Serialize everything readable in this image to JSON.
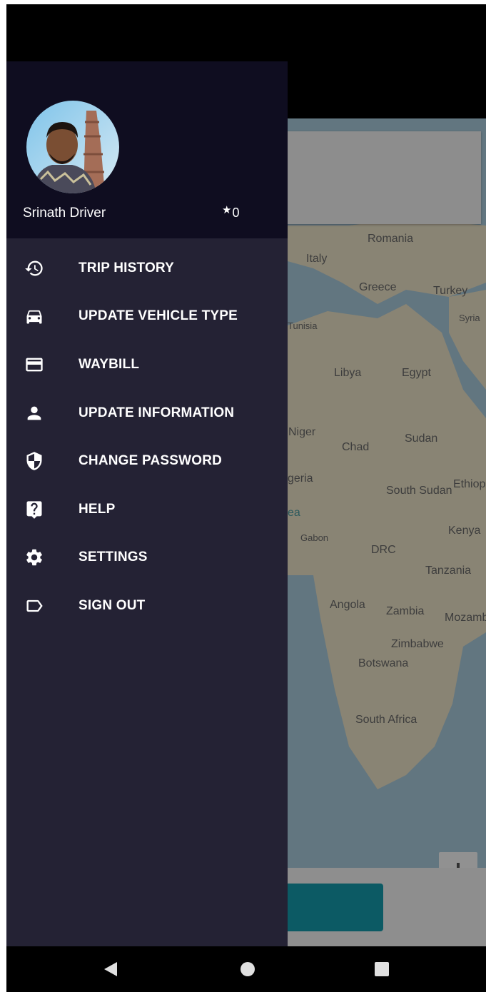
{
  "background_map": {
    "labels": [
      "Romania",
      "Italy",
      "Greece",
      "Turkey",
      "Syria",
      "Tunisia",
      "Libya",
      "Egypt",
      "Niger",
      "Chad",
      "Sudan",
      "geria",
      "South Sudan",
      "Ethiop",
      "ea",
      "Gabon",
      "Kenya",
      "DRC",
      "Tanzania",
      "Angola",
      "Zambia",
      "Mozamb",
      "Zimbabwe",
      "Botswana",
      "South Africa"
    ]
  },
  "drawer": {
    "driver_name": "Srinath Driver",
    "rating_star": "★",
    "rating_value": "0",
    "menu": [
      {
        "label": "TRIP HISTORY",
        "icon": "history-icon"
      },
      {
        "label": "UPDATE VEHICLE TYPE",
        "icon": "car-icon"
      },
      {
        "label": "WAYBILL",
        "icon": "credit-card-icon"
      },
      {
        "label": "UPDATE INFORMATION",
        "icon": "person-icon"
      },
      {
        "label": "CHANGE PASSWORD",
        "icon": "shield-icon"
      },
      {
        "label": "HELP",
        "icon": "help-icon"
      },
      {
        "label": "SETTINGS",
        "icon": "gear-icon"
      },
      {
        "label": "SIGN OUT",
        "icon": "label-outline-icon"
      }
    ]
  },
  "navbar": {
    "buttons": [
      "back-icon",
      "home-icon",
      "recents-icon"
    ]
  },
  "colors": {
    "drawer_bg": "#242234",
    "drawer_header_bg": "#0f0d20",
    "action_button": "#169bac"
  }
}
